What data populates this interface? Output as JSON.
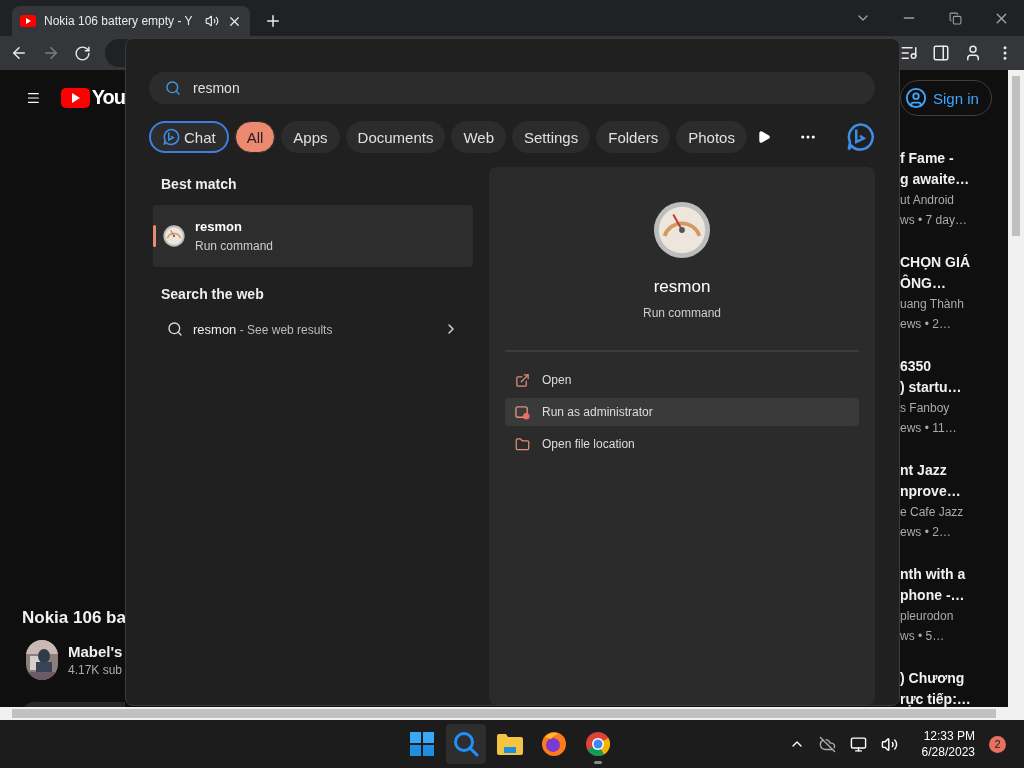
{
  "browser": {
    "tab": {
      "title": "Nokia 106 battery empty - Y",
      "audio": true
    },
    "forward_disabled": true
  },
  "youtube": {
    "logo_text": "You",
    "sign_in": "Sign in",
    "video_title": "Nokia 106 ba",
    "channel": "Mabel's",
    "subscribers": "4.17K sub",
    "recommendations": [
      {
        "title_lines": [
          "f Fame -",
          "g awaite…"
        ],
        "channel": "ut Android",
        "meta": "ws • 7 day…"
      },
      {
        "title_lines": [
          "CHỌN GIÁ",
          "ÔNG…"
        ],
        "channel": "uang Thành",
        "meta": "ews • 2…"
      },
      {
        "title_lines": [
          "6350",
          ") startu…"
        ],
        "channel": "s Fanboy",
        "meta": "ews • 11…"
      },
      {
        "title_lines": [
          "nt Jazz",
          "nprove…"
        ],
        "channel": "e Cafe Jazz",
        "meta": "ews • 2…"
      },
      {
        "title_lines": [
          "nth with a",
          "phone -…"
        ],
        "channel": "pleurodon",
        "meta": "ws • 5…"
      },
      {
        "title_lines": [
          ") Chương",
          "rực tiếp:…"
        ]
      }
    ]
  },
  "search": {
    "query": "resmon",
    "filters": [
      {
        "label": "Chat",
        "kind": "chat",
        "selected": false
      },
      {
        "label": "All",
        "kind": "chip",
        "selected": true
      },
      {
        "label": "Apps",
        "kind": "chip",
        "selected": false
      },
      {
        "label": "Documents",
        "kind": "chip",
        "selected": false
      },
      {
        "label": "Web",
        "kind": "chip",
        "selected": false
      },
      {
        "label": "Settings",
        "kind": "chip",
        "selected": false
      },
      {
        "label": "Folders",
        "kind": "chip",
        "selected": false
      },
      {
        "label": "Photos",
        "kind": "chip",
        "selected": false
      }
    ],
    "best_match_heading": "Best match",
    "best_match": {
      "name": "resmon",
      "type": "Run command",
      "selected": true
    },
    "web_heading": "Search the web",
    "web_result": {
      "query": "resmon",
      "suffix": " - See web results"
    },
    "preview": {
      "name": "resmon",
      "type": "Run command"
    },
    "actions": [
      {
        "label": "Open",
        "kind": "open",
        "hovered": false
      },
      {
        "label": "Run as administrator",
        "kind": "admin",
        "hovered": true
      },
      {
        "label": "Open file location",
        "kind": "folder",
        "hovered": false
      }
    ]
  },
  "taskbar": {
    "apps": [
      {
        "kind": "start",
        "selected": false,
        "running": false
      },
      {
        "kind": "search",
        "selected": true,
        "running": false
      },
      {
        "kind": "files",
        "selected": false,
        "running": false
      },
      {
        "kind": "firefox",
        "selected": false,
        "running": false
      },
      {
        "kind": "chrome",
        "selected": false,
        "running": true
      }
    ],
    "time": "12:33 PM",
    "date": "6/28/2023",
    "notifications": "2"
  }
}
